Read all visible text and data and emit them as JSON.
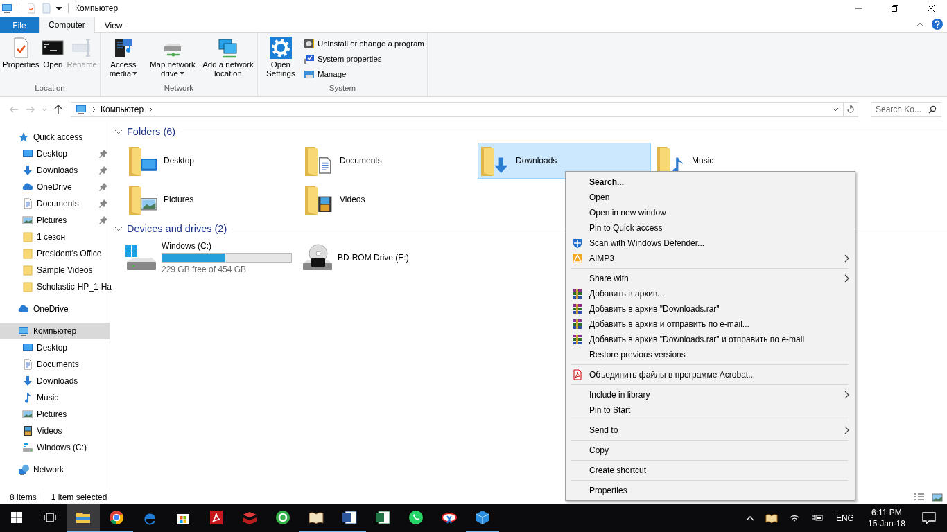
{
  "window": {
    "title": "Компьютер"
  },
  "ribbon": {
    "tabs": [
      {
        "label": "File",
        "kind": "file",
        "selected": false
      },
      {
        "label": "Computer",
        "kind": "tab",
        "selected": true
      },
      {
        "label": "View",
        "kind": "tab",
        "selected": false
      }
    ],
    "groups": [
      {
        "label": "Location",
        "buttons": [
          {
            "label": "Properties",
            "kind": "properties",
            "disabled": false,
            "dropdown": false
          },
          {
            "label": "Open",
            "kind": "console",
            "disabled": false,
            "dropdown": false
          },
          {
            "label": "Rename",
            "kind": "rename",
            "disabled": true,
            "dropdown": false
          }
        ]
      },
      {
        "label": "Network",
        "buttons": [
          {
            "label": "Access media",
            "kind": "media",
            "disabled": false,
            "dropdown": true
          },
          {
            "label": "Map network drive",
            "kind": "netdrive",
            "disabled": false,
            "dropdown": true
          },
          {
            "label": "Add a network location",
            "kind": "netlocation",
            "disabled": false,
            "dropdown": false
          }
        ]
      },
      {
        "label": "System",
        "buttons": [
          {
            "label": "Open Settings",
            "kind": "settings",
            "disabled": false,
            "dropdown": false
          }
        ],
        "small_buttons": [
          {
            "label": "Uninstall or change a program",
            "kind": "disc"
          },
          {
            "label": "System properties",
            "kind": "sysprops"
          },
          {
            "label": "Manage",
            "kind": "manage"
          }
        ]
      }
    ]
  },
  "address": {
    "path": "Компьютер",
    "search_placeholder": "Search Ko..."
  },
  "nav": [
    {
      "label": "Quick access",
      "kind": "quick",
      "selected": false,
      "children": [
        {
          "label": "Desktop",
          "kind": "desktop",
          "selected": false,
          "pinned": true
        },
        {
          "label": "Downloads",
          "kind": "downloads",
          "selected": false,
          "pinned": true
        },
        {
          "label": "OneDrive",
          "kind": "onedrive",
          "selected": false,
          "pinned": true
        },
        {
          "label": "Documents",
          "kind": "documents",
          "selected": false,
          "pinned": true
        },
        {
          "label": "Pictures",
          "kind": "pictures",
          "selected": false,
          "pinned": true
        },
        {
          "label": "1 сезон",
          "kind": "folder",
          "selected": false,
          "pinned": false
        },
        {
          "label": "President's Office",
          "kind": "folder",
          "selected": false,
          "pinned": false
        },
        {
          "label": "Sample Videos",
          "kind": "folder",
          "selected": false,
          "pinned": false
        },
        {
          "label": "Scholastic-HP_1-Ha",
          "kind": "folder",
          "selected": false,
          "pinned": false
        }
      ]
    },
    {
      "label": "OneDrive",
      "kind": "onedrive",
      "selected": false
    },
    {
      "label": "Компьютер",
      "kind": "computer",
      "selected": true,
      "children": [
        {
          "label": "Desktop",
          "kind": "desktop",
          "selected": false,
          "pinned": false
        },
        {
          "label": "Documents",
          "kind": "documents",
          "selected": false,
          "pinned": false
        },
        {
          "label": "Downloads",
          "kind": "downloads",
          "selected": false,
          "pinned": false
        },
        {
          "label": "Music",
          "kind": "music",
          "selected": false,
          "pinned": false
        },
        {
          "label": "Pictures",
          "kind": "pictures",
          "selected": false,
          "pinned": false
        },
        {
          "label": "Videos",
          "kind": "videos",
          "selected": false,
          "pinned": false
        },
        {
          "label": "Windows (C:)",
          "kind": "drive",
          "selected": false,
          "pinned": false
        }
      ]
    },
    {
      "label": "Network",
      "kind": "network",
      "selected": false
    }
  ],
  "folders": {
    "title": "Folders (6)",
    "items": [
      {
        "label": "Desktop",
        "kind": "desktop",
        "selected": false
      },
      {
        "label": "Documents",
        "kind": "documents",
        "selected": false
      },
      {
        "label": "Downloads",
        "kind": "downloads",
        "selected": true
      },
      {
        "label": "Music",
        "kind": "music",
        "selected": false
      },
      {
        "label": "Pictures",
        "kind": "pictures",
        "selected": false
      },
      {
        "label": "Videos",
        "kind": "videos",
        "selected": false
      }
    ]
  },
  "drives": {
    "title": "Devices and drives (2)",
    "items": [
      {
        "label": "Windows (C:)",
        "kind": "disk",
        "level": 0.49,
        "free": "229 GB free of 454 GB"
      },
      {
        "label": "BD-ROM Drive (E:)",
        "kind": "optical"
      }
    ]
  },
  "context_menu": {
    "items": [
      {
        "label": "Search...",
        "kind": "default",
        "submenu": false
      },
      {
        "label": "Open",
        "kind": "plain",
        "submenu": false
      },
      {
        "label": "Open in new window",
        "kind": "plain",
        "submenu": false
      },
      {
        "label": "Pin to Quick access",
        "kind": "plain",
        "submenu": false
      },
      {
        "label": "Scan with Windows Defender...",
        "kind": "shield",
        "submenu": false
      },
      {
        "label": "AIMP3",
        "kind": "triangle",
        "submenu": true
      },
      {
        "kind": "separator"
      },
      {
        "label": "Share with",
        "kind": "plain",
        "submenu": true
      },
      {
        "label": "Добавить в архив...",
        "kind": "books",
        "submenu": false
      },
      {
        "label": "Добавить в архив \"Downloads.rar\"",
        "kind": "books",
        "submenu": false
      },
      {
        "label": "Добавить в архив и отправить по e-mail...",
        "kind": "books",
        "submenu": false
      },
      {
        "label": "Добавить в архив \"Downloads.rar\" и отправить по e-mail",
        "kind": "books",
        "submenu": false
      },
      {
        "label": "Restore previous versions",
        "kind": "plain",
        "submenu": false
      },
      {
        "kind": "separator"
      },
      {
        "label": "Объединить файлы в программе Acrobat...",
        "kind": "pdf",
        "submenu": false
      },
      {
        "kind": "separator"
      },
      {
        "label": "Include in library",
        "kind": "plain",
        "submenu": true
      },
      {
        "label": "Pin to Start",
        "kind": "plain",
        "submenu": false
      },
      {
        "kind": "separator"
      },
      {
        "label": "Send to",
        "kind": "plain",
        "submenu": true
      },
      {
        "kind": "separator"
      },
      {
        "label": "Copy",
        "kind": "plain",
        "submenu": false
      },
      {
        "kind": "separator"
      },
      {
        "label": "Create shortcut",
        "kind": "plain",
        "submenu": false
      },
      {
        "kind": "separator"
      },
      {
        "label": "Properties",
        "kind": "plain",
        "submenu": false
      }
    ]
  },
  "status_bar": {
    "item_count": "8 items",
    "selection": "1 item selected"
  },
  "taskbar": {
    "apps": [
      {
        "kind": "explorer",
        "running": true,
        "selected": true
      },
      {
        "kind": "chrome",
        "running": true,
        "selected": false
      },
      {
        "kind": "edge",
        "running": false,
        "selected": false
      },
      {
        "kind": "store",
        "running": false,
        "selected": false
      },
      {
        "kind": "acrobat",
        "running": false,
        "selected": false
      },
      {
        "kind": "books",
        "running": false,
        "selected": false
      },
      {
        "kind": "mail",
        "running": false,
        "selected": false
      },
      {
        "kind": "reader",
        "running": true,
        "selected": false
      },
      {
        "kind": "word",
        "running": true,
        "selected": false
      },
      {
        "kind": "excel",
        "running": false,
        "selected": false
      },
      {
        "kind": "whatsapp",
        "running": false,
        "selected": false
      },
      {
        "kind": "snip",
        "running": false,
        "selected": false
      },
      {
        "kind": "cube",
        "running": true,
        "selected": false
      }
    ],
    "language": "ENG",
    "time": "6:11 PM",
    "date": "15-Jan-18"
  }
}
